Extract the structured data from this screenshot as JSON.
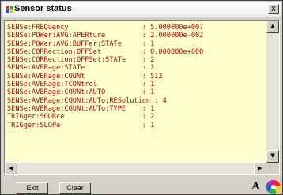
{
  "window": {
    "title": "Sensor status",
    "close_label": "x"
  },
  "content": {
    "lines": [
      "SENSe:FREQuency                  : 5.000000e+007",
      "SENSe:POWer:AVG:APERture         : 2.000000e-002",
      "SENSe:POWer:AVG:BUFFer:STATe     : 1",
      "SENSe:CORRection:OFFSet          : 0.000000e+000",
      "SENSe:CORRection:OFFSet:STATe    : 2",
      "SENSe:AVERage:STATe              : 2",
      "SENSe:AVERage:COUNt              : 512",
      "SENSe:AVERage:TCONtrol           : 1",
      "SENSe:AVERage:COUNt:AUTO         : 1",
      "SENSe:AVERage:COUNt:AUTo:RESolution : 4",
      "SENSe:AVERage:COUNt:AUTo:TYPE    : 1",
      "TRIGger:SOURce                   : 2",
      "TRIGger:SLOPe                    : 1"
    ],
    "text_color": "#b40000",
    "background_color": "#ffffd0"
  },
  "buttons": {
    "exit_label": "Exit",
    "clear_label": "Clear",
    "font_label": "A"
  },
  "icons": {
    "title": "sensor-status-icon",
    "scroll_up": "arrow-up-icon",
    "scroll_down": "arrow-down-icon",
    "scroll_left": "arrow-left-icon",
    "scroll_right": "arrow-right-icon",
    "color": "color-wheel-icon"
  }
}
